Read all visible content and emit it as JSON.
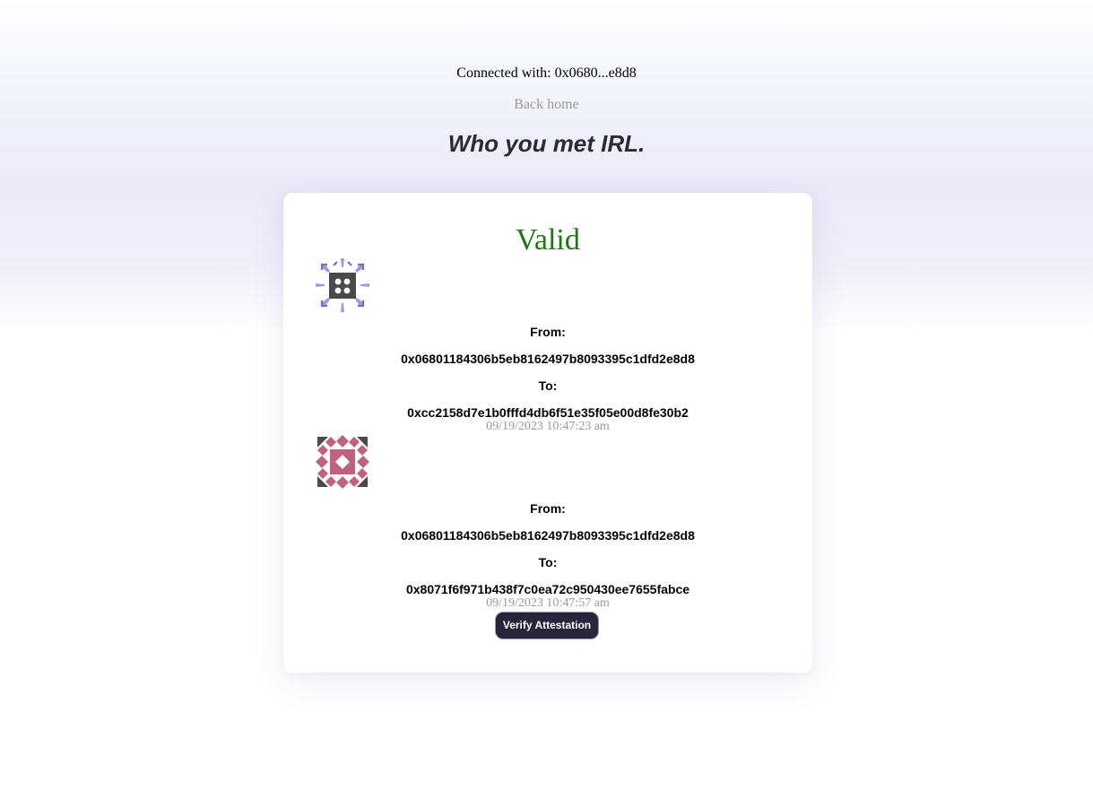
{
  "header": {
    "connected_label": "Connected with: 0x0680...e8d8",
    "back_home": "Back home",
    "title": "Who you met IRL."
  },
  "card": {
    "status": "Valid",
    "status_color": "#207614",
    "attestations": [
      {
        "avatar_icon": "identicon-avatar",
        "from_label": "From:",
        "from": "0x06801184306b5eb8162497b8093395c1dfd2e8d8",
        "to_label": "To:",
        "to": "0xcc2158d7e1b0fffd4db6f51e35f05e00d8fe30b2",
        "timestamp": "09/19/2023 10:47:23 am"
      },
      {
        "avatar_icon": "identicon-avatar",
        "from_label": "From:",
        "from": "0x06801184306b5eb8162497b8093395c1dfd2e8d8",
        "to_label": "To:",
        "to": "0x8071f6f971b438f7c0ea72c950430ee7655fabce",
        "timestamp": "09/19/2023 10:47:57 am"
      }
    ],
    "verify_button": "Verify Attestation"
  },
  "colors": {
    "title": "#2b2a3a",
    "muted": "#9a9a9a",
    "button_bg": "#26253a"
  }
}
